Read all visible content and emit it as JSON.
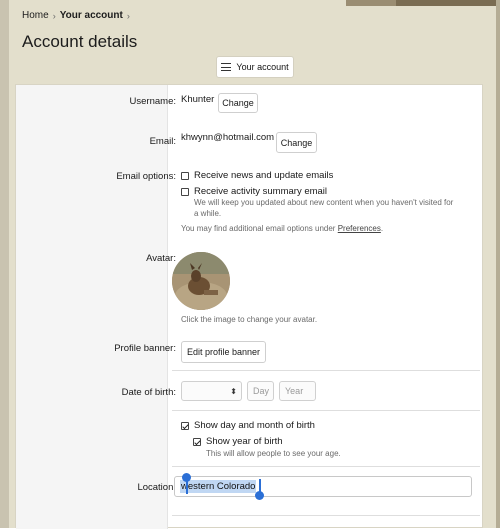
{
  "breadcrumb": {
    "home": "Home",
    "current": "Your account",
    "sep": "›"
  },
  "page_title": "Account details",
  "menu_button": {
    "label": "Your account",
    "icon": "hamburger-icon"
  },
  "fields": {
    "username": {
      "label": "Username:",
      "value": "Khunter",
      "button": "Change"
    },
    "email": {
      "label": "Email:",
      "value": "khwynn@hotmail.com",
      "button": "Change"
    },
    "email_options": {
      "label": "Email options:",
      "opt1": {
        "label": "Receive news and update emails",
        "checked": false
      },
      "opt2": {
        "label": "Receive activity summary email",
        "checked": false
      },
      "opt2_hint_1": "We will keep you updated about new content when you haven't visited for",
      "opt2_hint_2": "a while.",
      "more_hint": "You may find additional email options under",
      "more_link": "Preferences",
      "more_end": "."
    },
    "avatar": {
      "label": "Avatar:",
      "hint": "Click the image to change your avatar."
    },
    "banner": {
      "label": "Profile banner:",
      "button": "Edit profile banner"
    },
    "dob": {
      "label": "Date of birth:",
      "month_value": "",
      "day_placeholder": "Day",
      "year_placeholder": "Year",
      "show_day_month": {
        "label": "Show day and month of birth",
        "checked": true
      },
      "show_year": {
        "label": "Show year of birth",
        "checked": true
      },
      "show_year_hint": "This will allow people to see your age."
    },
    "location": {
      "label": "Location:",
      "value": "western Colorado"
    }
  },
  "colors": {
    "page_bg": "#e3dfcc",
    "selection": "#c0d7f3",
    "handle": "#2b6fd6"
  }
}
